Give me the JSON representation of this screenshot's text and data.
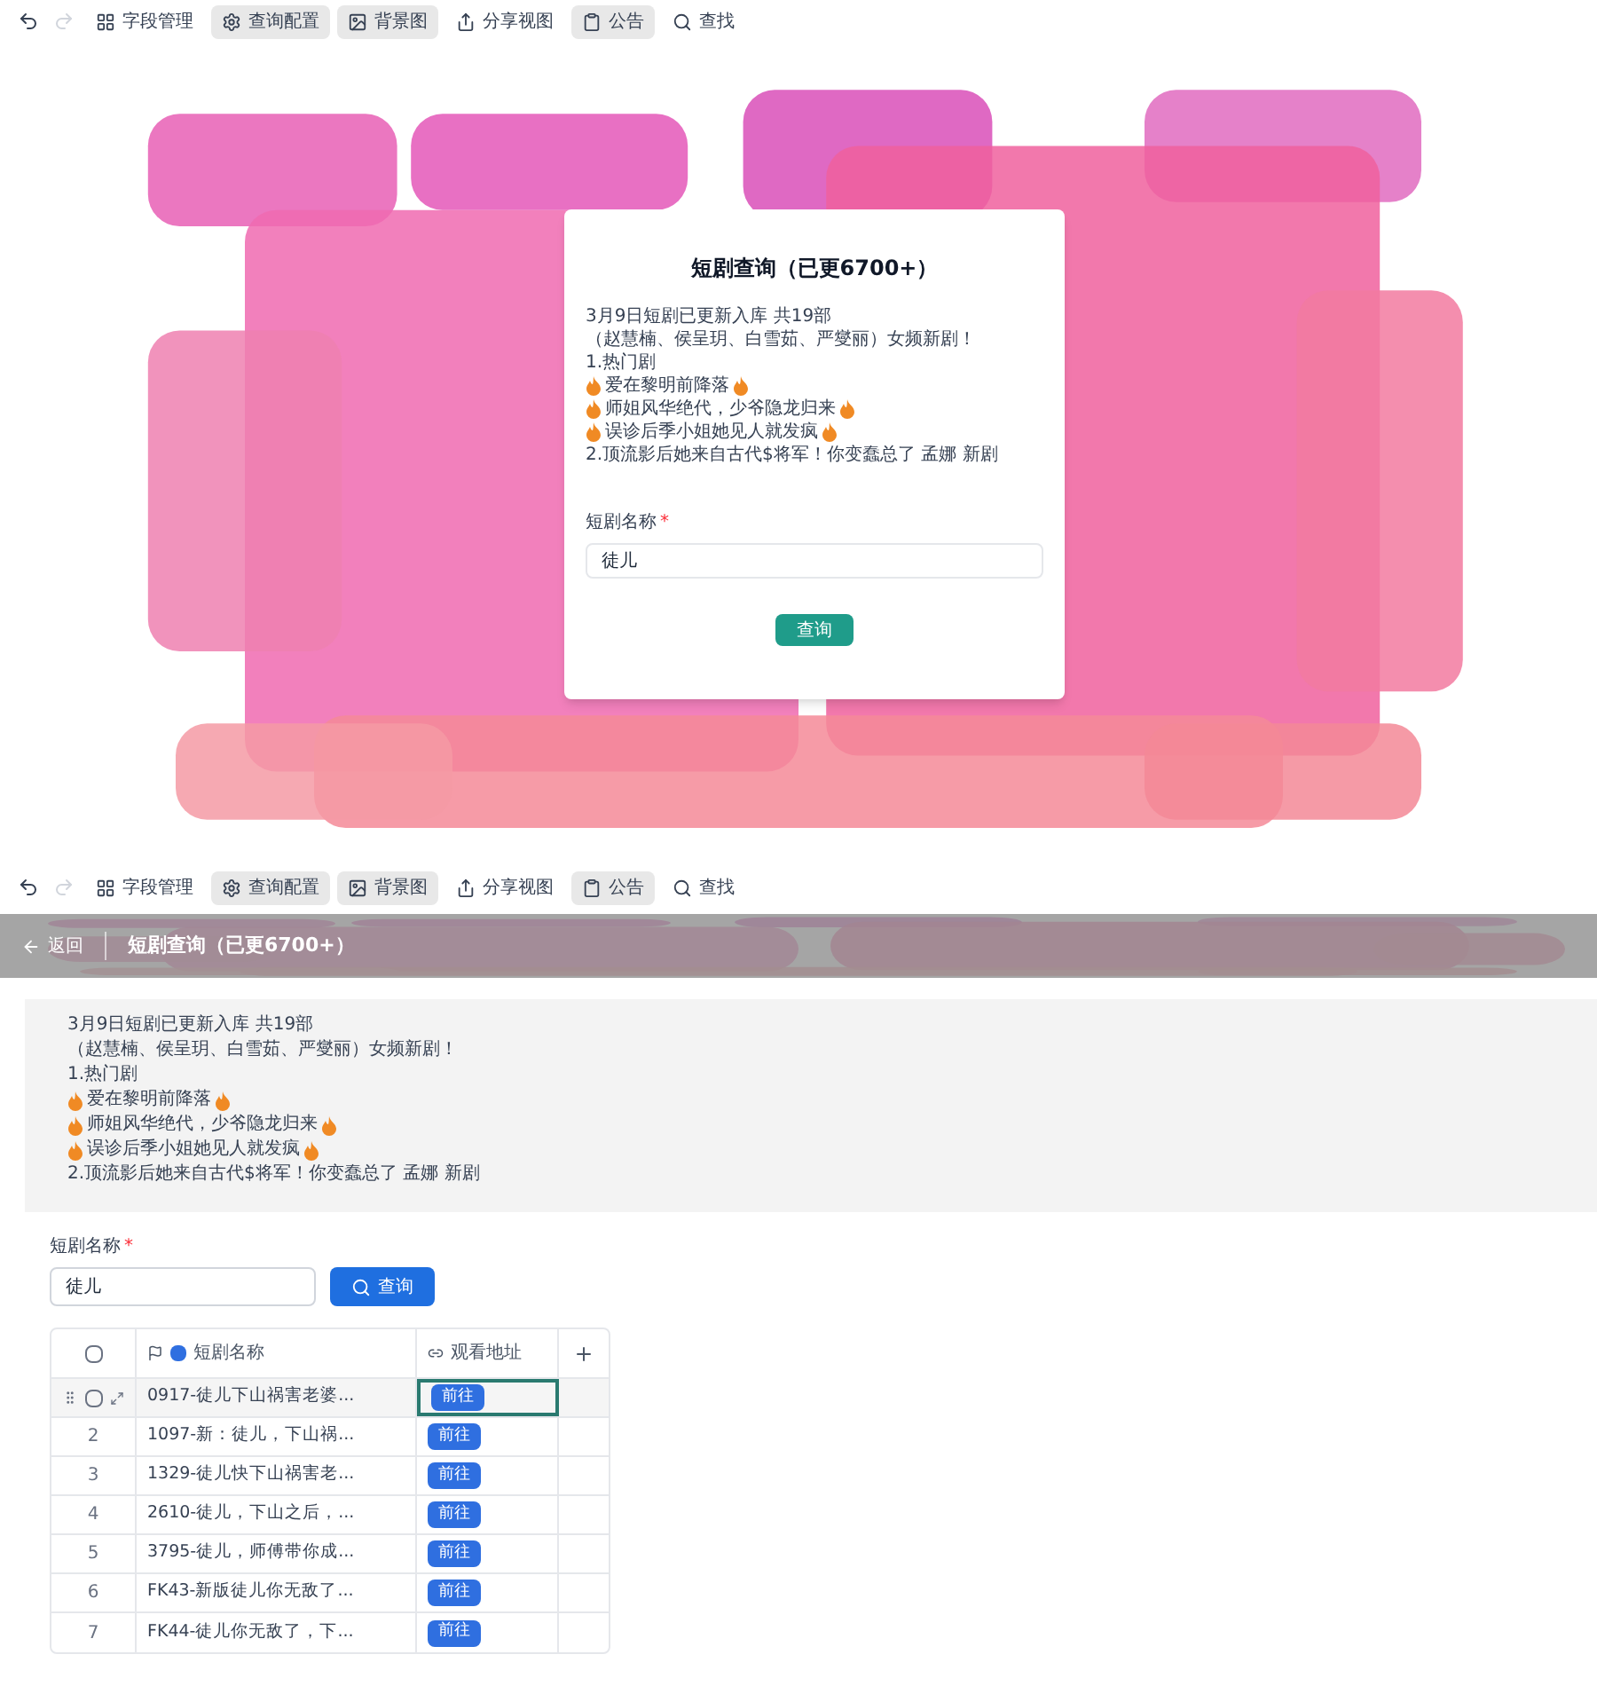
{
  "toolbars": [
    {
      "history": [
        {
          "disabled": false
        },
        {
          "disabled": true
        }
      ],
      "items": [
        {
          "label": "字段管理",
          "active": false
        },
        {
          "label": "查询配置",
          "active": true
        },
        {
          "label": "背景图",
          "active": true
        },
        {
          "label": "分享视图",
          "active": false
        },
        {
          "label": "公告",
          "active": true
        },
        {
          "label": "查找",
          "active": false
        }
      ]
    },
    {
      "history": [
        {
          "disabled": false
        },
        {
          "disabled": true
        }
      ],
      "items": [
        {
          "label": "字段管理",
          "active": false
        },
        {
          "label": "查询配置",
          "active": true
        },
        {
          "label": "背景图",
          "active": true
        },
        {
          "label": "分享视图",
          "active": false
        },
        {
          "label": "公告",
          "active": true
        },
        {
          "label": "查找",
          "active": false
        }
      ]
    }
  ],
  "preview": {
    "dialog": {
      "title": "短剧查询（已更6700+）",
      "notice": [
        {
          "text": "3月9日短剧已更新入库 共19部",
          "flame_before": false,
          "flame_after": false
        },
        {
          "text": "（赵慧楠、侯呈玥、白雪茹、严燮丽）女频新剧！",
          "flame_before": false,
          "flame_after": false
        },
        {
          "text": "1.热门剧",
          "flame_before": false,
          "flame_after": false
        },
        {
          "text": "爱在黎明前降落",
          "flame_before": true,
          "flame_after": true
        },
        {
          "text": "师姐风华绝代，少爷隐龙归来",
          "flame_before": true,
          "flame_after": true
        },
        {
          "text": "误诊后季小姐她见人就发疯",
          "flame_before": true,
          "flame_after": true
        },
        {
          "text": "2.顶流影后她来自古代$将军！你变蠢总了 孟娜 新剧",
          "flame_before": false,
          "flame_after": false
        }
      ],
      "field_label": "短剧名称",
      "required_mark": "*",
      "field_value": "徒儿",
      "button": "查询"
    }
  },
  "page": {
    "back": "返回",
    "title": "短剧查询（已更6700+）",
    "notice": [
      {
        "text": "3月9日短剧已更新入库 共19部",
        "flame_before": false,
        "flame_after": false
      },
      {
        "text": "（赵慧楠、侯呈玥、白雪茹、严燮丽）女频新剧！",
        "flame_before": false,
        "flame_after": false
      },
      {
        "text": "1.热门剧",
        "flame_before": false,
        "flame_after": false
      },
      {
        "text": "爱在黎明前降落",
        "flame_before": true,
        "flame_after": true
      },
      {
        "text": "师姐风华绝代，少爷隐龙归来",
        "flame_before": true,
        "flame_after": true
      },
      {
        "text": "误诊后季小姐她见人就发疯",
        "flame_before": true,
        "flame_after": true
      },
      {
        "text": "2.顶流影后她来自古代$将军！你变蠢总了 孟娜 新剧",
        "flame_before": false,
        "flame_after": false
      }
    ],
    "field_label": "短剧名称",
    "required_mark": "*",
    "field_value": "徒儿",
    "button": "查询",
    "table": {
      "all_checked": false,
      "columns": [
        {
          "label": "短剧名称"
        },
        {
          "label": "观看地址"
        }
      ],
      "rows": [
        {
          "name": "0917-徒儿下山祸害老婆...",
          "link": "前往",
          "hovered": true,
          "checked": false,
          "selected": true
        },
        {
          "number": "2",
          "name": "1097-新：徒儿，下山祸...",
          "link": "前往",
          "hovered": false,
          "selected": false
        },
        {
          "number": "3",
          "name": "1329-徒儿快下山祸害老...",
          "link": "前往",
          "hovered": false,
          "selected": false
        },
        {
          "number": "4",
          "name": "2610-徒儿，下山之后，...",
          "link": "前往",
          "hovered": false,
          "selected": false
        },
        {
          "number": "5",
          "name": "3795-徒儿，师傅带你成...",
          "link": "前往",
          "hovered": false,
          "selected": false
        },
        {
          "number": "6",
          "name": "FK43-新版徒儿你无敌了...",
          "link": "前往",
          "hovered": false,
          "selected": false
        },
        {
          "number": "7",
          "name": "FK44-徒儿你无敌了，下...",
          "link": "前往",
          "hovered": false,
          "selected": false
        }
      ]
    }
  }
}
